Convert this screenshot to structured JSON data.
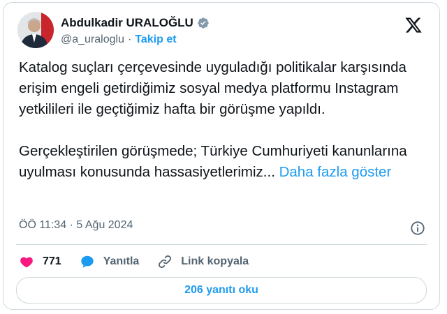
{
  "author": {
    "display_name": "Abdulkadir URALOĞLU",
    "handle": "@a_uraloglu",
    "separator": "·",
    "follow_label": "Takip et"
  },
  "tweet": {
    "paragraph1": "Katalog suçları çerçevesinde uyguladığı politikalar karşısında erişim engeli getirdiğimiz sosyal medya platformu Instagram yetkilileri ile geçtiğimiz hafta bir görüşme yapıldı.",
    "paragraph2": "Gerçekleştirilen görüşmede; Türkiye Cumhuriyeti kanunlarına uyulması konusunda hassasiyetlerimiz...",
    "show_more_label": "Daha fazla göster"
  },
  "meta": {
    "timestamp": "ÖÖ 11:34 · 5 Ağu 2024"
  },
  "actions": {
    "likes_count": "771",
    "reply_label": "Yanıtla",
    "copy_link_label": "Link kopyala"
  },
  "replies_button_label": "206 yanıtı oku",
  "icons": {
    "verified": "verified-badge-icon",
    "platform": "x-logo-icon",
    "info": "info-icon",
    "like": "heart-icon",
    "reply": "speech-bubble-icon",
    "link": "link-icon"
  },
  "colors": {
    "accent": "#1d9bf0",
    "like": "#f91880",
    "text": "#0f1419",
    "muted": "#536471",
    "border": "#cfd9de"
  }
}
